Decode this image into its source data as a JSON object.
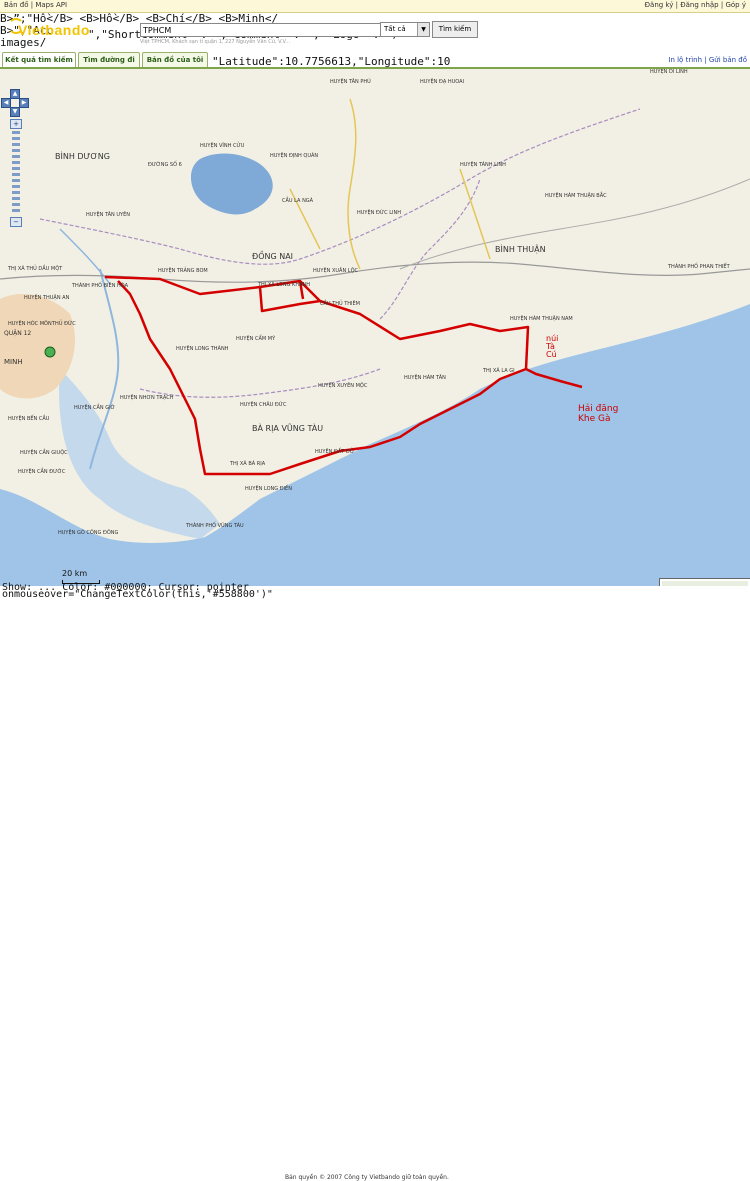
{
  "topbar": {
    "map": "Bản đồ",
    "sep": "|",
    "maps_api": "Maps API",
    "register": "Đăng ký",
    "login": "Đăng nhập",
    "help": "Góp ý"
  },
  "raw_lines": [
    "B>”;\"Hồ</B> <B>Hồ</B> <B>Chí</B> <B>Minh</",
    "B>\",\"Acc",
    "images/"
  ],
  "raw_frag1": "\",\"ShortComment\" : \",\"Comment\" : \", \"Logo\" : \"/",
  "raw_frag2": "\"Latitude\":10.7756613,\"Longitude\":10",
  "raw_bottom1": "Show: ... Color: #000000; Cursor: pointer",
  "raw_bottom2": "onmouseover=\"ChangeTextColor(this,'#558800')\"",
  "logo": {
    "text": "Vietbando"
  },
  "search": {
    "value": "TPHCM",
    "select": "Tất cả",
    "button": "Tìm kiếm",
    "address": "Việt TPHCM, Khách sạn tỉ quận 1, 227 Nguyễn Văn Cừ, V.V..."
  },
  "tabs": [
    "Kết quả tìm kiếm",
    "Tìm đường đi",
    "Bản đồ của tôi"
  ],
  "toplinks": {
    "print": "In lộ trình",
    "send": "Gửi bản đồ"
  },
  "map": {
    "scale": "20 km",
    "copyright": "Bản quyền © 2007 Công ty Vietbando giữ toàn quyền.",
    "annotations": {
      "nui_line1": "núi",
      "nui_line2": "Tà",
      "nui_line3": "Cú",
      "haidang_line1": "Hải đăng",
      "haidang_line2": "Khe Gà"
    },
    "labels": [
      {
        "t": "BÌNH DƯƠNG",
        "c": "#333"
      },
      {
        "t": "ĐỒNG NAI",
        "c": "#333"
      },
      {
        "t": "BÌNH THUẬN",
        "c": "#333"
      },
      {
        "t": "BÀ RỊA VŨNG TÀU",
        "c": "#333"
      },
      {
        "t": "MINH",
        "c": "#333"
      },
      {
        "t": "HUYỆN TÂN PHÚ",
        "c": "#333"
      },
      {
        "t": "HUYỆN ĐẠ HUOAI",
        "c": "#333"
      },
      {
        "t": "HUYỆN DI LINH",
        "c": "#333"
      },
      {
        "t": "HUYỆN VĨNH CỬU",
        "c": "#333"
      },
      {
        "t": "HUYỆN ĐỊNH QUÁN",
        "c": "#333"
      },
      {
        "t": "HUYỆN TÁNH LINH",
        "c": "#333"
      },
      {
        "t": "HUYỆN TÂN UYÊN",
        "c": "#333"
      },
      {
        "t": "HUYỆN ĐỨC LINH",
        "c": "#333"
      },
      {
        "t": "HUYỆN HÀM THUẬN BẮC",
        "c": "#333"
      },
      {
        "t": "HUYỆN TRẢNG BOM",
        "c": "#333"
      },
      {
        "t": "HUYỆN XUÂN LỘC",
        "c": "#333"
      },
      {
        "t": "THỊ XÃ THỦ DẦU MỘT",
        "c": "#333"
      },
      {
        "t": "THÀNH PHỐ BIÊN HÒA",
        "c": "#333"
      },
      {
        "t": "THỊ XÃ LONG KHÁNH",
        "c": "#333"
      },
      {
        "t": "HUYỆN THUẬN AN",
        "c": "#333"
      },
      {
        "t": "HUYỆN HÀM THUẬN NAM",
        "c": "#333"
      },
      {
        "t": "THÀNH PHỐ PHAN THIẾT",
        "c": "#333"
      },
      {
        "t": "HUYỆN LONG THÀNH",
        "c": "#333"
      },
      {
        "t": "HUYỆN CẨM MỸ",
        "c": "#333"
      },
      {
        "t": "HUYỆN HÀM TÂN",
        "c": "#333"
      },
      {
        "t": "THỊ XÃ LA GI",
        "c": "#333"
      },
      {
        "t": "HUYỆN NHƠN TRẠCH",
        "c": "#333"
      },
      {
        "t": "HUYỆN CHÂU ĐỨC",
        "c": "#333"
      },
      {
        "t": "HUYỆN XUYÊN MỘC",
        "c": "#333"
      },
      {
        "t": "HUYỆN CẦN GIỜ",
        "c": "#333"
      },
      {
        "t": "THỊ XÃ BÀ RỊA",
        "c": "#333"
      },
      {
        "t": "HUYỆN ĐẤT ĐỎ",
        "c": "#333"
      },
      {
        "t": "HUYỆN LONG ĐIỀN",
        "c": "#333"
      },
      {
        "t": "THÀNH PHỐ VŨNG TÀU",
        "c": "#333"
      },
      {
        "t": "HUYỆN GÒ CÔNG ĐÔNG",
        "c": "#333"
      },
      {
        "t": "HUYỆN CẦN ĐƯỚC",
        "c": "#333"
      },
      {
        "t": "HUYỆN HÓC MÔN",
        "c": "#333"
      },
      {
        "t": "QUẬN 12",
        "c": "#333"
      },
      {
        "t": "THỦ ĐỨC",
        "c": "#333"
      },
      {
        "t": "HUYỆN BẾN CẦU",
        "c": "#333"
      },
      {
        "t": "HUYỆN CẦN GIUỘC",
        "c": "#333"
      },
      {
        "t": "CẦU LA NGÀ",
        "c": "#333"
      },
      {
        "t": "ĐƯỜNG SỐ 6",
        "c": "#333"
      },
      {
        "t": "CẦU THỦ THIÊM",
        "c": "#333"
      }
    ],
    "colors": {
      "sea": "#9fc4e8",
      "land": "#f2f0e4",
      "route": "#d40000",
      "road": "#c9a640"
    }
  }
}
